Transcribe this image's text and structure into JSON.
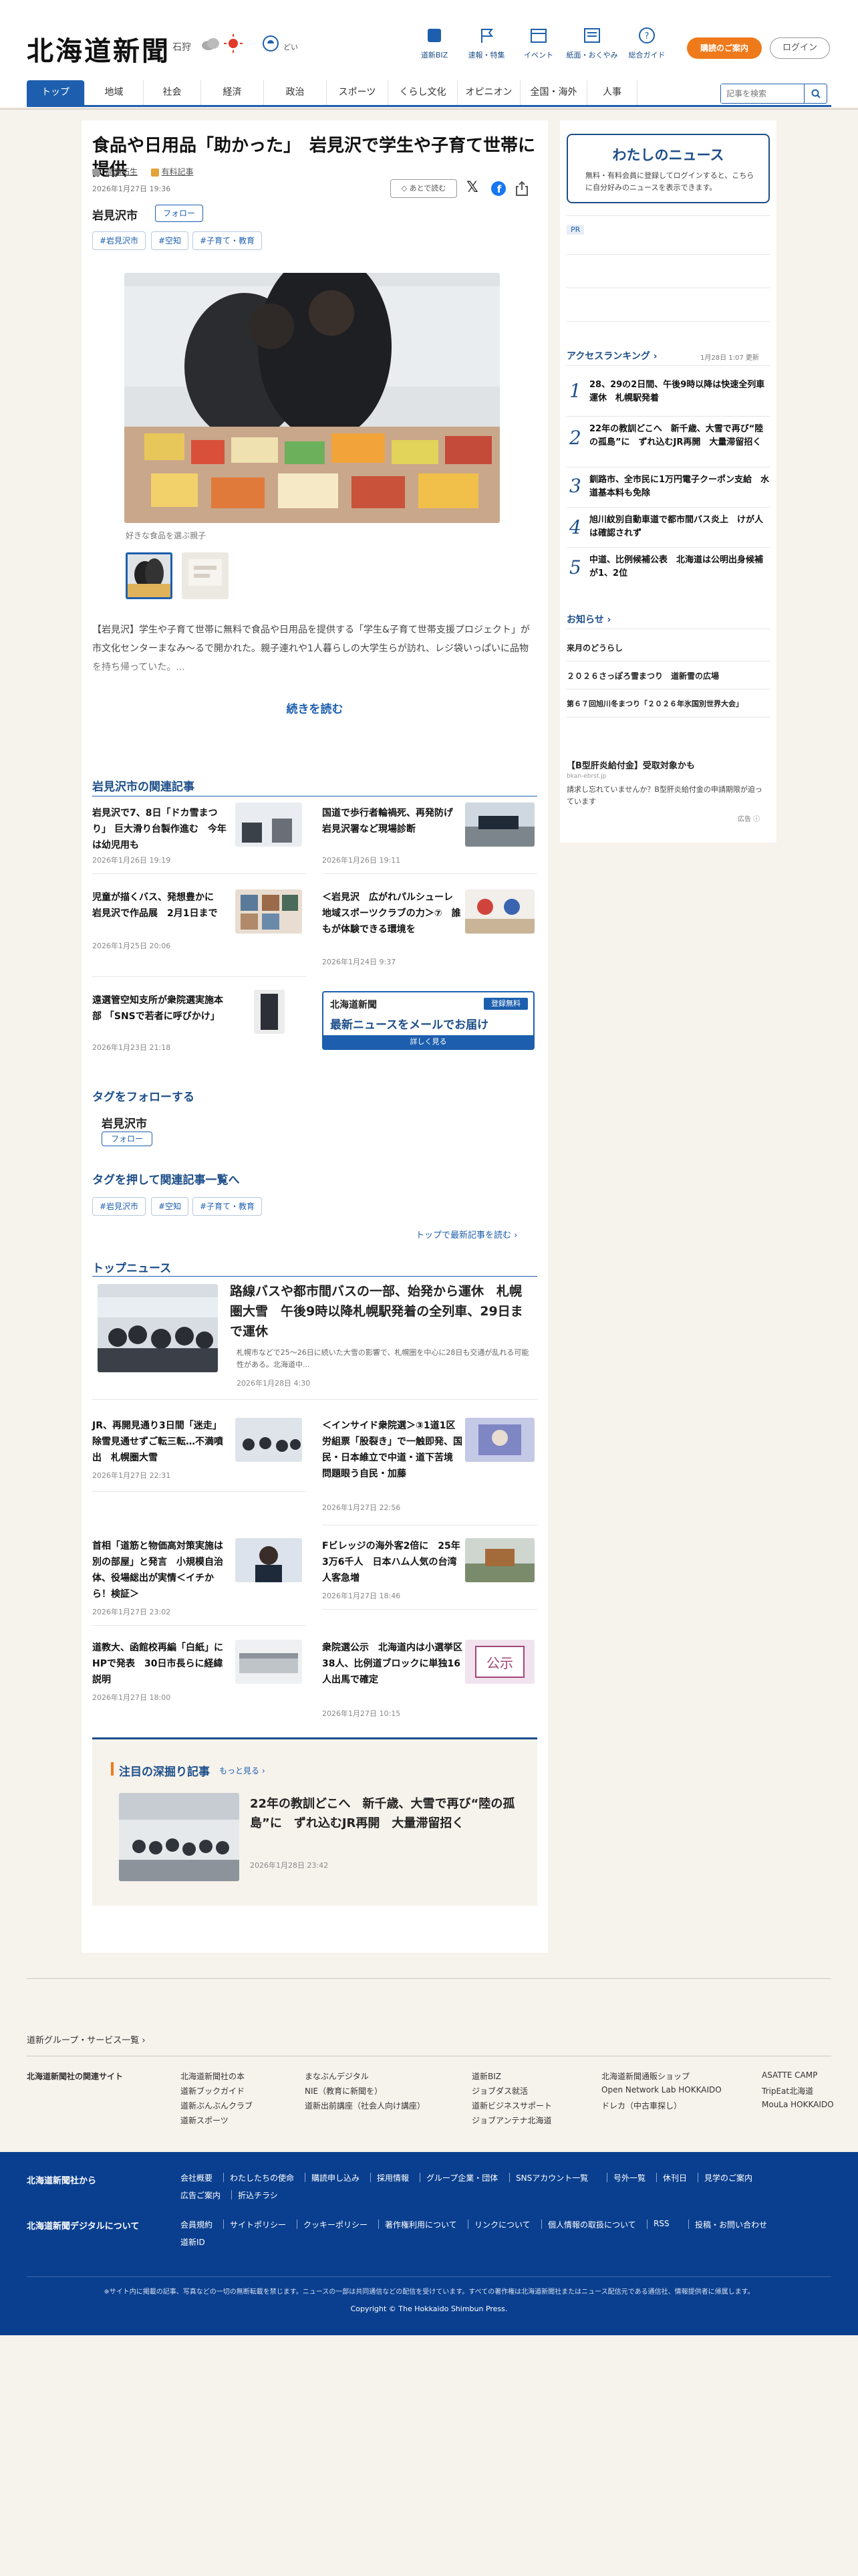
{
  "header": {
    "logo": "北海道新聞",
    "city": "石狩",
    "weather": "どい",
    "icons": [
      "道新BIZ",
      "速報・特集",
      "イベント",
      "紙面・おくやみ",
      "総合ガイド"
    ],
    "subscribe": "購読のご案内",
    "login": "ログイン",
    "search_placeholder": "記事を検索"
  },
  "nav": [
    "トップ",
    "地域",
    "社会",
    "経済",
    "政治",
    "スポーツ",
    "くらし文化",
    "オピニオン",
    "全国・海外",
    "人事"
  ],
  "article": {
    "title": "食品や日用品「助かった」　岩見沢で学生や子育て世帯に提供",
    "author": "高瀬拓生",
    "badge": "有料記事",
    "date": "2026年1月27日 19:36",
    "city": "岩見沢市",
    "follow": "フォロー",
    "later": "あとで読む",
    "tags": [
      "#岩見沢市",
      "#空知",
      "#子育て・教育"
    ],
    "caption": "好きな食品を選ぶ親子",
    "body": "【岩見沢】学生や子育て世帯に無料で食品や日用品を提供する「学生&子育て世帯支援プロジェクト」が市文化センターまなみ～るで開かれた。親子連れや1人暮らしの大学生らが訪れ、レジ袋いっぱいに品物を持ち帰っていた。...",
    "readmore": "続きを読む"
  },
  "related": {
    "title": "岩見沢市の関連記事",
    "items": [
      {
        "t": "岩見沢で7、8日「ドカ雪まつり」 巨大滑り台製作進む　今年は幼児用も",
        "d": "2026年1月26日 19:19"
      },
      {
        "t": "国道で歩行者輪禍死、再発防げ　岩見沢署など現場診断",
        "d": "2026年1月26日 19:11"
      },
      {
        "t": "児童が描くバス、発想豊かに　岩見沢で作品展　2月1日まで",
        "d": "2026年1月25日 20:06"
      },
      {
        "t": "＜岩見沢　広がれパルシューレ　地域スポーツクラブの力＞⑦　誰もが体験できる環境を",
        "d": "2026年1月24日 9:37"
      },
      {
        "t": "遠選管空知支所が衆院選実施本部 「SNSで若者に呼びかけ」",
        "d": "2026年1月23日 21:18"
      }
    ],
    "ad_logo": "北海道新聞",
    "ad_badge": "登録無料",
    "ad_text": "最新ニュースをメールでお届け",
    "ad_more": "詳しく見る"
  },
  "follow_tags": {
    "title": "タグをフォローする",
    "name": "岩見沢市",
    "btn": "フォロー"
  },
  "tag_links": {
    "title": "タグを押して関連記事一覧へ",
    "tags": [
      "#岩見沢市",
      "#空知",
      "#子育て・教育"
    ],
    "more": "トップで最新記事を読む"
  },
  "top_news": {
    "title": "トップニュース",
    "lead": {
      "t": "路線バスや都市間バスの一部、始発から運休　札幌圏大雪　午後9時以降札幌駅発着の全列車、29日まで運休",
      "s": "札幌市などで25～26日に続いた大雪の影響で、札幌圏を中心に28日も交通が乱れる可能性がある。北海道中...",
      "d": "2026年1月28日 4:30"
    },
    "items": [
      {
        "t": "JR、再開見通り3日間「迷走」　除雪見通せずご転三転…不満噴出　札幌圏大雪",
        "d": "2026年1月27日 22:31"
      },
      {
        "t": "＜インサイド衆院選＞③1道1区　労組票「股裂き」で一触即発、国民・日本維立で中道・道下苦境　問題眼う自民・加藤",
        "d": "2026年1月27日 22:56"
      },
      {
        "t": "首相「道筋と物価高対策実施は別の部屋」と発言　小規模自治体、役場総出が実情＜イチから！検証＞",
        "d": "2026年1月27日 23:02"
      },
      {
        "t": "Fビレッジの海外客2倍に　25年3万6千人　日本ハム人気の台湾人客急増",
        "d": "2026年1月27日 18:46"
      },
      {
        "t": "道教大、函館校再編「白紙」に　HPで発表　30日市長らに経緯説明",
        "d": "2026年1月27日 18:00"
      },
      {
        "t": "衆院選公示　北海道内は小選挙区38人、比例道ブロックに単独16人出馬で確定",
        "d": "2026年1月27日 10:15"
      }
    ]
  },
  "deep": {
    "title": "注目の深掘り記事",
    "more": "もっと見る",
    "t": "22年の教訓どこへ　新千歳、大雪で再び“陸の孤島”に　ずれ込むJR再開　大量滞留招く",
    "d": "2026年1月28日 23:42"
  },
  "side": {
    "mynews_title": "わたしのニュース",
    "mynews_text": "無料・有料会員に登録してログインすると、こちらに自分好みのニュースを表示できます。",
    "pr": "PR",
    "rank_title": "アクセスランキング",
    "rank_time": "1月28日 1:07 更新",
    "ranks": [
      "28、29の2日間、午後9時以降は快速全列車運休　札幌駅発着",
      "22年の教訓どこへ　新千歳、大雪で再び“陸の孤島”に　ずれ込むJR再開　大量滞留招く",
      "釧路市、全市民に1万円電子クーポン支給　水道基本料も免除",
      "旭川紋別自動車道で都市間バス炎上　けが人は確認されず",
      "中道、比例候補公表　北海道は公明出身候補が1、2位"
    ],
    "notice_title": "お知らせ",
    "notices": [
      "来月のどうらし",
      "２０２６さっぽろ雪まつり　道新雪の広場",
      "第６７回旭川冬まつり「２０２６年氷国別世界大会」"
    ],
    "promo_title": "【B型肝炎給付金】受取対象かも",
    "promo_src": "bkan-ebrst.jp",
    "promo_text": "請求し忘れていませんか？B型肝炎給付金の申請期限が迫っています",
    "ad": "広告"
  },
  "footer": {
    "group": "道新グループ・サービス一覧",
    "related_label": "北海道新聞社の関連サイト",
    "related": [
      [
        "北海道新聞社の本",
        "まなぶんデジタル",
        "道新BIZ",
        "北海道新聞通販ショップ",
        "ASATTE CAMP"
      ],
      [
        "道新ブックガイド",
        "NIE（教育に新聞を）",
        "ジョブダス就活",
        "Open Network Lab HOKKAIDO",
        "TripEat北海道"
      ],
      [
        "道新ぶんぶんクラブ",
        "道新出前講座（社会人向け講座）",
        "道新ビジネスサポート",
        "ドレカ（中古車探し）",
        "MouLa HOKKAIDO"
      ],
      [
        "道新スポーツ",
        "",
        "ジョブアンテナ北海道",
        "",
        ""
      ]
    ],
    "from_label": "北海道新聞社から",
    "from_links": [
      "会社概要",
      "わたしたちの使命",
      "購読申し込み",
      "採用情報",
      "グループ企業・団体",
      "SNSアカウント一覧",
      "号外一覧",
      "休刊日",
      "見学のご案内",
      "広告ご案内",
      "折込チラシ"
    ],
    "digital_label": "北海道新聞デジタルについて",
    "digital_links": [
      "会員規約",
      "サイトポリシー",
      "クッキーポリシー",
      "著作権利用について",
      "リンクについて",
      "個人情報の取扱について",
      "RSS",
      "投稿・お問い合わせ",
      "道新ID"
    ],
    "notice": "※サイト内に掲載の記事、写真などの一切の無断転載を禁じます。ニュースの一部は共同通信などの配信を受けています。すべての著作権は北海道新聞社またはニュース配信元である通信社、情報提供者に帰属します。",
    "copyright": "Copyright © The Hokkaido Shimbun Press."
  },
  "colors": {
    "brand": "#1d5fae",
    "accent": "#ee7a1b",
    "footer": "#0a3f8f"
  }
}
